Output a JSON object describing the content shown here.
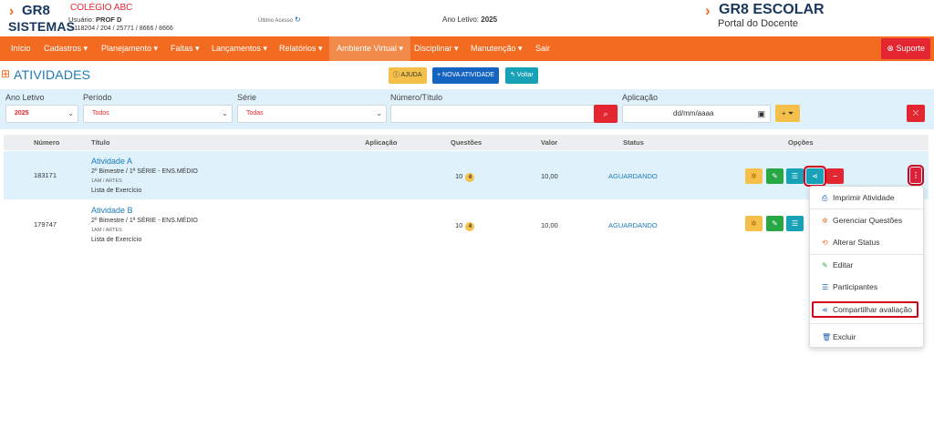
{
  "header": {
    "logo_top": "GR8",
    "logo_bottom": "SISTEMAS",
    "school": "COLÉGIO ABC",
    "user_label": "Usuário:",
    "user_name": "PROF D",
    "user_codes": "- 118204 / 204 / 25771 / 8666 / 8666",
    "last_access_label": "Último Acesso",
    "ano_letivo_label": "Ano Letivo:",
    "ano_letivo_value": "2025",
    "brand_name": "GR8 ESCOLAR",
    "brand_sub": "Portal do Docente"
  },
  "nav": {
    "items": [
      {
        "label": "Início"
      },
      {
        "label": "Cadastros ▾"
      },
      {
        "label": "Planejamento ▾"
      },
      {
        "label": "Faltas ▾"
      },
      {
        "label": "Lançamentos ▾"
      },
      {
        "label": "Relatórios ▾"
      },
      {
        "label": "Ambiente Virtual ▾"
      },
      {
        "label": "Disciplinar ▾"
      },
      {
        "label": "Manutenção ▾"
      },
      {
        "label": "Sair"
      }
    ],
    "support": "⊗ Suporte"
  },
  "page": {
    "title": "ATIVIDADES",
    "help": "ⓘ AJUDA",
    "new": "+ NOVA ATIVIDADE",
    "back": "↰ Voltar"
  },
  "filters": {
    "ano_label": "Ano Letivo",
    "ano_value": "2025",
    "periodo_label": "Período",
    "periodo_value": "Todos",
    "serie_label": "Série",
    "serie_value": "Todas",
    "numero_label": "Número/Título",
    "aplicacao_label": "Aplicação",
    "date_placeholder": "dd/mm/aaaa"
  },
  "table": {
    "headers": [
      "Número",
      "Título",
      "Aplicação",
      "Questões",
      "Valor",
      "Status",
      "Opções"
    ],
    "rows": [
      {
        "numero": "183171",
        "titulo": "Atividade A",
        "line2": "2º Bimestre / 1ª SÉRIE - ENS.MÉDIO",
        "line3": "1AM / ARTES",
        "line4": "Lista de Exercício",
        "questoes": "10",
        "badge": "4",
        "valor": "10,00",
        "status": "AGUARDANDO"
      },
      {
        "numero": "179747",
        "titulo": "Atividade B",
        "line2": "2º Bimestre / 1ª SÉRIE - ENS.MÉDIO",
        "line3": "1AM / ARTES",
        "line4": "Lista de Exercício",
        "questoes": "10",
        "badge": "4",
        "valor": "10,00",
        "status": "AGUARDANDO"
      }
    ]
  },
  "dropdown": {
    "items": [
      {
        "label": "Imprimir Atividade",
        "icon": "⎙",
        "color": "#1a5cb0"
      },
      {
        "label": "Gerenciar Questões",
        "icon": "✲",
        "color": "#f26b21"
      },
      {
        "label": "Alterar Status",
        "icon": "⟲",
        "color": "#f26b21"
      },
      {
        "label": "Editar",
        "icon": "✎",
        "color": "#28a745"
      },
      {
        "label": "Participantes",
        "icon": "☰",
        "color": "#1a5cb0"
      },
      {
        "label": "Compartilhar avaliação",
        "icon": "⋖",
        "color": "#1a5cb0"
      },
      {
        "label": "Excluir",
        "icon": "🗑",
        "color": "#1a5cb0"
      }
    ]
  }
}
